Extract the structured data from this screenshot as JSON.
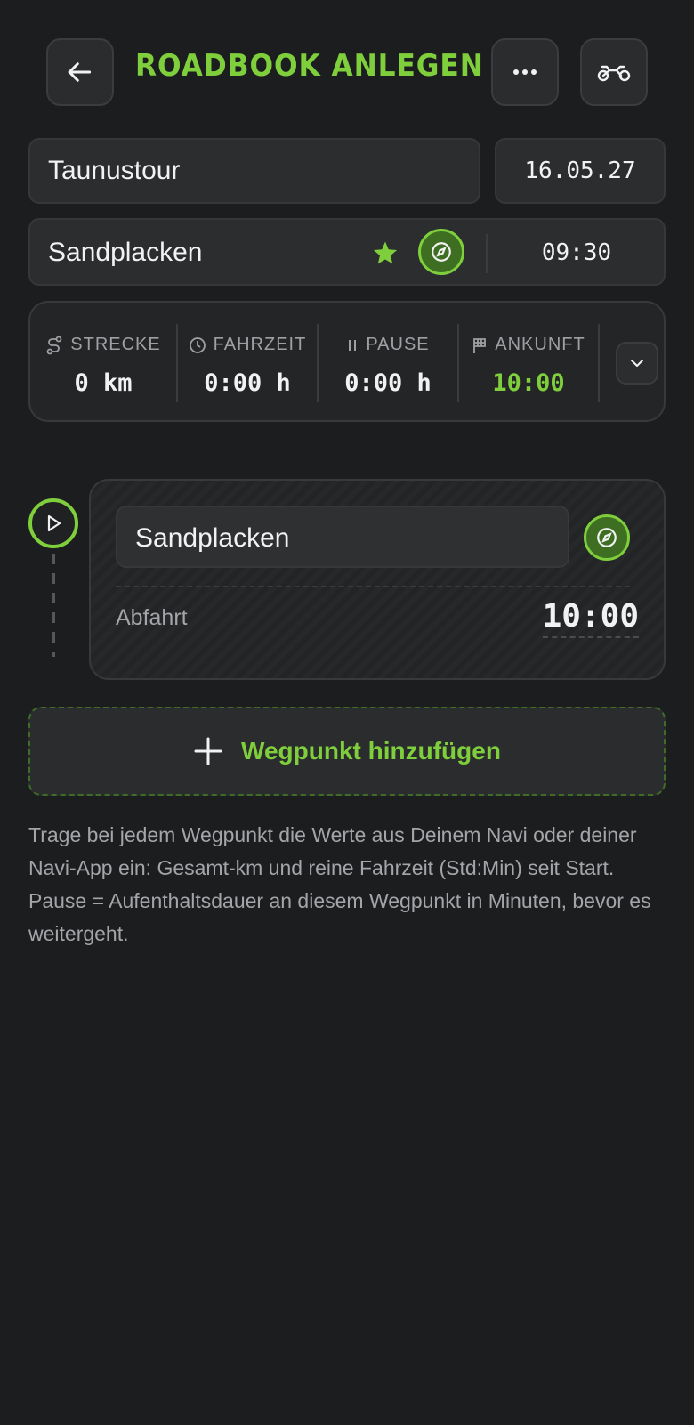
{
  "header": {
    "title": "ROADBOOK ANLEGEN",
    "back_icon": "arrow-left-icon",
    "menu_icon": "more-horizontal-icon",
    "bike_icon": "motorcycle-icon"
  },
  "tour": {
    "name": "Taunustour",
    "date": "16.05.27",
    "start_location": "Sandplacken",
    "start_time": "09:30"
  },
  "stats": {
    "distance": {
      "label": "STRECKE",
      "value": "0 km"
    },
    "ride_time": {
      "label": "FAHRZEIT",
      "value": "0:00 h"
    },
    "pause": {
      "label": "PAUSE",
      "value": "0:00 h"
    },
    "arrival": {
      "label": "ANKUNFT",
      "value": "10:00"
    }
  },
  "waypoint": {
    "name": "Sandplacken",
    "departure_label": "Abfahrt",
    "departure_time": "10:00"
  },
  "add_waypoint": {
    "label": "Wegpunkt hinzufügen"
  },
  "hint": "Trage bei jedem Wegpunkt die Werte aus Deinem Navi oder deiner Navi-App ein: Gesamt-km und reine Fahrzeit (Std:Min) seit Start. Pause = Aufenthaltsdauer an diesem Wegpunkt in Minuten, bevor es weitergeht.",
  "colors": {
    "accent": "#7fce3c",
    "background": "#1c1d1f",
    "card": "#2b2d2f"
  }
}
